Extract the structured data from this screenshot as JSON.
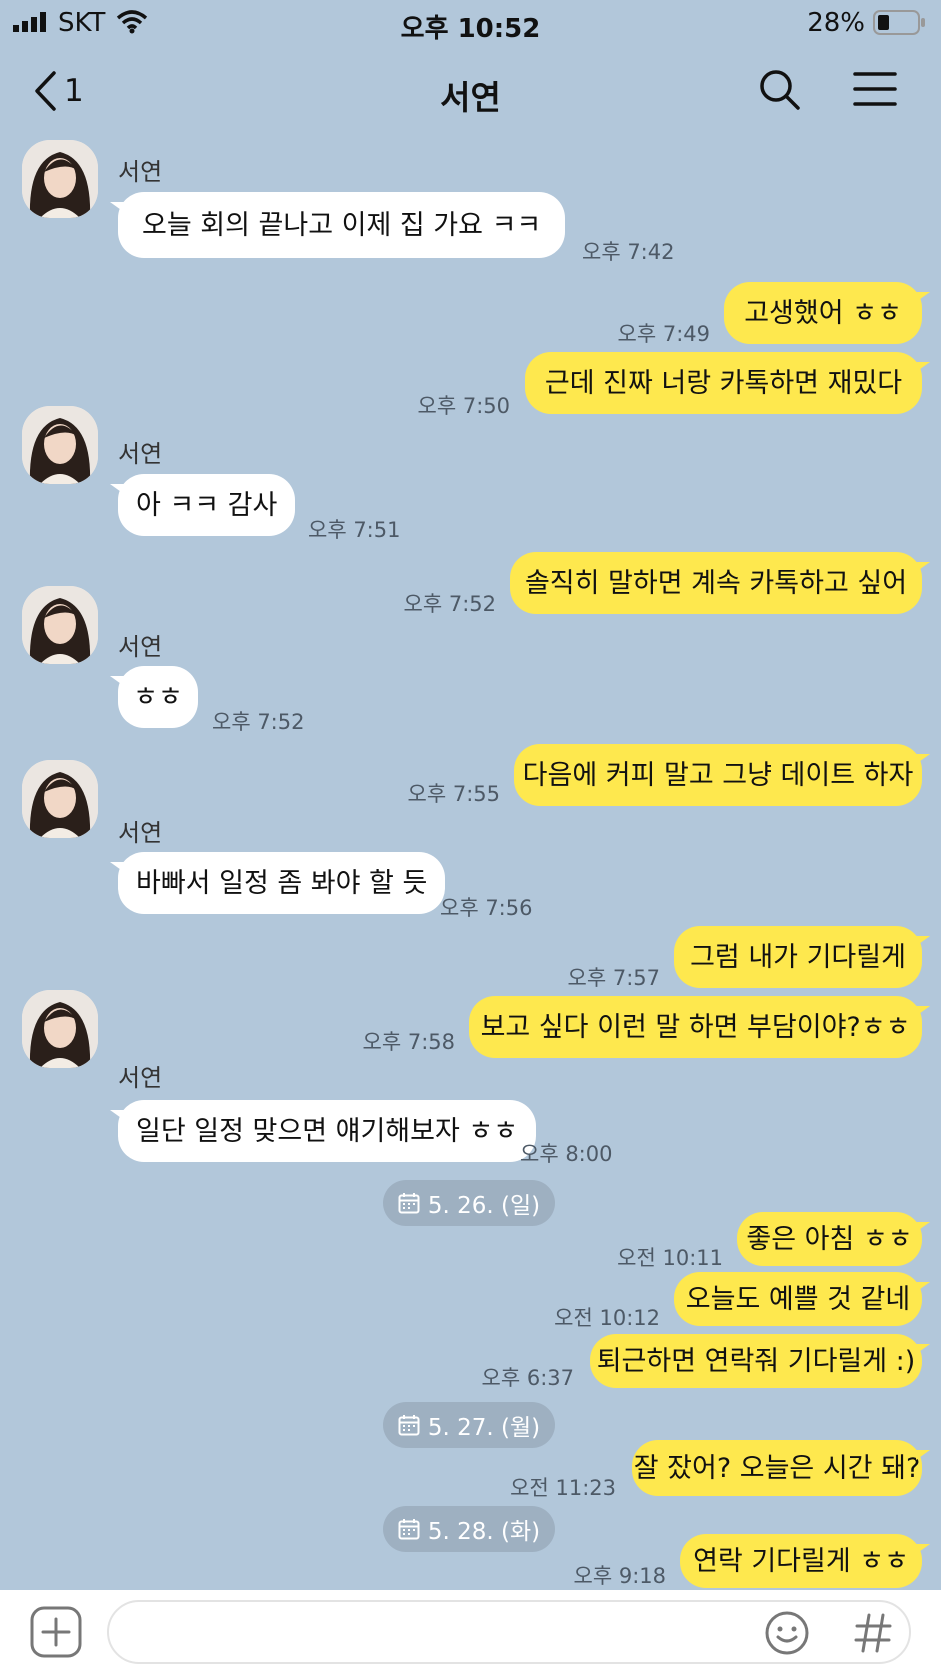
{
  "status": {
    "carrier": "SKT",
    "time": "오후 10:52",
    "battery": "28%"
  },
  "header": {
    "back_count": "1",
    "title": "서연"
  },
  "messages": [
    {
      "sender": "서연",
      "text": "오늘 회의 끝나고 이제 집 가요 ㅋㅋ",
      "time": "오후 7:42"
    },
    {
      "text": "고생했어 ㅎㅎ",
      "time": "오후 7:49"
    },
    {
      "text": "근데 진짜 너랑 카톡하면 재밌다",
      "time": "오후 7:50"
    },
    {
      "sender": "서연",
      "text": "아 ㅋㅋ 감사",
      "time": "오후 7:51"
    },
    {
      "text": "솔직히 말하면 계속 카톡하고 싶어",
      "time": "오후 7:52"
    },
    {
      "sender": "서연",
      "text": "ㅎㅎ",
      "time": "오후 7:52"
    },
    {
      "text": "다음에 커피 말고 그냥 데이트 하자",
      "time": "오후 7:55"
    },
    {
      "sender": "서연",
      "text": "바빠서 일정 좀 봐야 할 듯",
      "time": "오후 7:56"
    },
    {
      "text": "그럼 내가 기다릴게",
      "time": "오후 7:57"
    },
    {
      "text": "보고 싶다 이런 말 하면 부담이야?ㅎㅎ",
      "time": "오후 7:58"
    },
    {
      "sender": "서연",
      "text": "일단 일정 맞으면 얘기해보자 ㅎㅎ",
      "time": "오후 8:00"
    },
    {
      "text": "좋은 아침 ㅎㅎ",
      "time": "오전 10:11"
    },
    {
      "text": "오늘도 예쁠 것 같네",
      "time": "오전 10:12"
    },
    {
      "text": "퇴근하면 연락줘 기다릴게 :)",
      "time": "오후 6:37"
    },
    {
      "text": "잘 잤어? 오늘은 시간 돼?",
      "time": "오전 11:23"
    },
    {
      "text": "연락 기다릴게 ㅎㅎ",
      "time": "오후 9:18"
    }
  ],
  "dates": [
    "5. 26. (일)",
    "5. 27. (월)",
    "5. 28. (화)"
  ],
  "colors": {
    "background": "#b2c7da",
    "outgoing": "#fee84e",
    "incoming": "#ffffff"
  },
  "icons": [
    "signal-icon",
    "wifi-icon",
    "battery-icon",
    "back-chevron-icon",
    "search-icon",
    "menu-icon",
    "calendar-icon",
    "plus-icon",
    "emoji-icon",
    "hashtag-icon"
  ]
}
